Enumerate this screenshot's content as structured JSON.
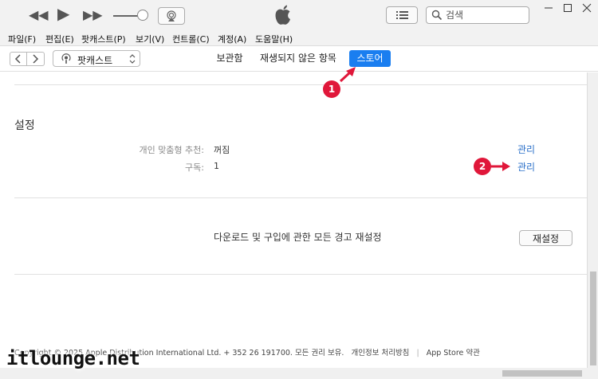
{
  "search": {
    "placeholder": "검색"
  },
  "menu": [
    "파일(F)",
    "편집(E)",
    "팟캐스트(P)",
    "보기(V)",
    "컨트롤(C)",
    "계정(A)",
    "도움말(H)"
  ],
  "nav": {
    "media_kind": "팟캐스트",
    "tabs": [
      {
        "label": "보관함",
        "active": false
      },
      {
        "label": "재생되지 않은 항목",
        "active": false
      },
      {
        "label": "스토어",
        "active": true
      }
    ]
  },
  "settings": {
    "title": "설정",
    "rows": [
      {
        "label": "개인 맞춤형 추천:",
        "value": "꺼짐",
        "action": "관리"
      },
      {
        "label": "구독:",
        "value": "1",
        "action": "관리"
      }
    ]
  },
  "reset": {
    "text": "다운로드 및 구입에 관한 모든 경고 재설정",
    "button": "재설정"
  },
  "footer": {
    "copyright": "Copyright © 2025 Apple Distribution International Ltd. + 352 26 191700. 모든 권리 보유.",
    "privacy": "개인정보 처리방침",
    "separator": "|",
    "terms": "App Store 약관"
  },
  "annotations": {
    "badge1": "1",
    "badge2": "2"
  },
  "watermark": "itlounge.net",
  "colors": {
    "accent": "#1a7ef0",
    "link": "#2a6fc9",
    "callout": "#e0173a"
  }
}
